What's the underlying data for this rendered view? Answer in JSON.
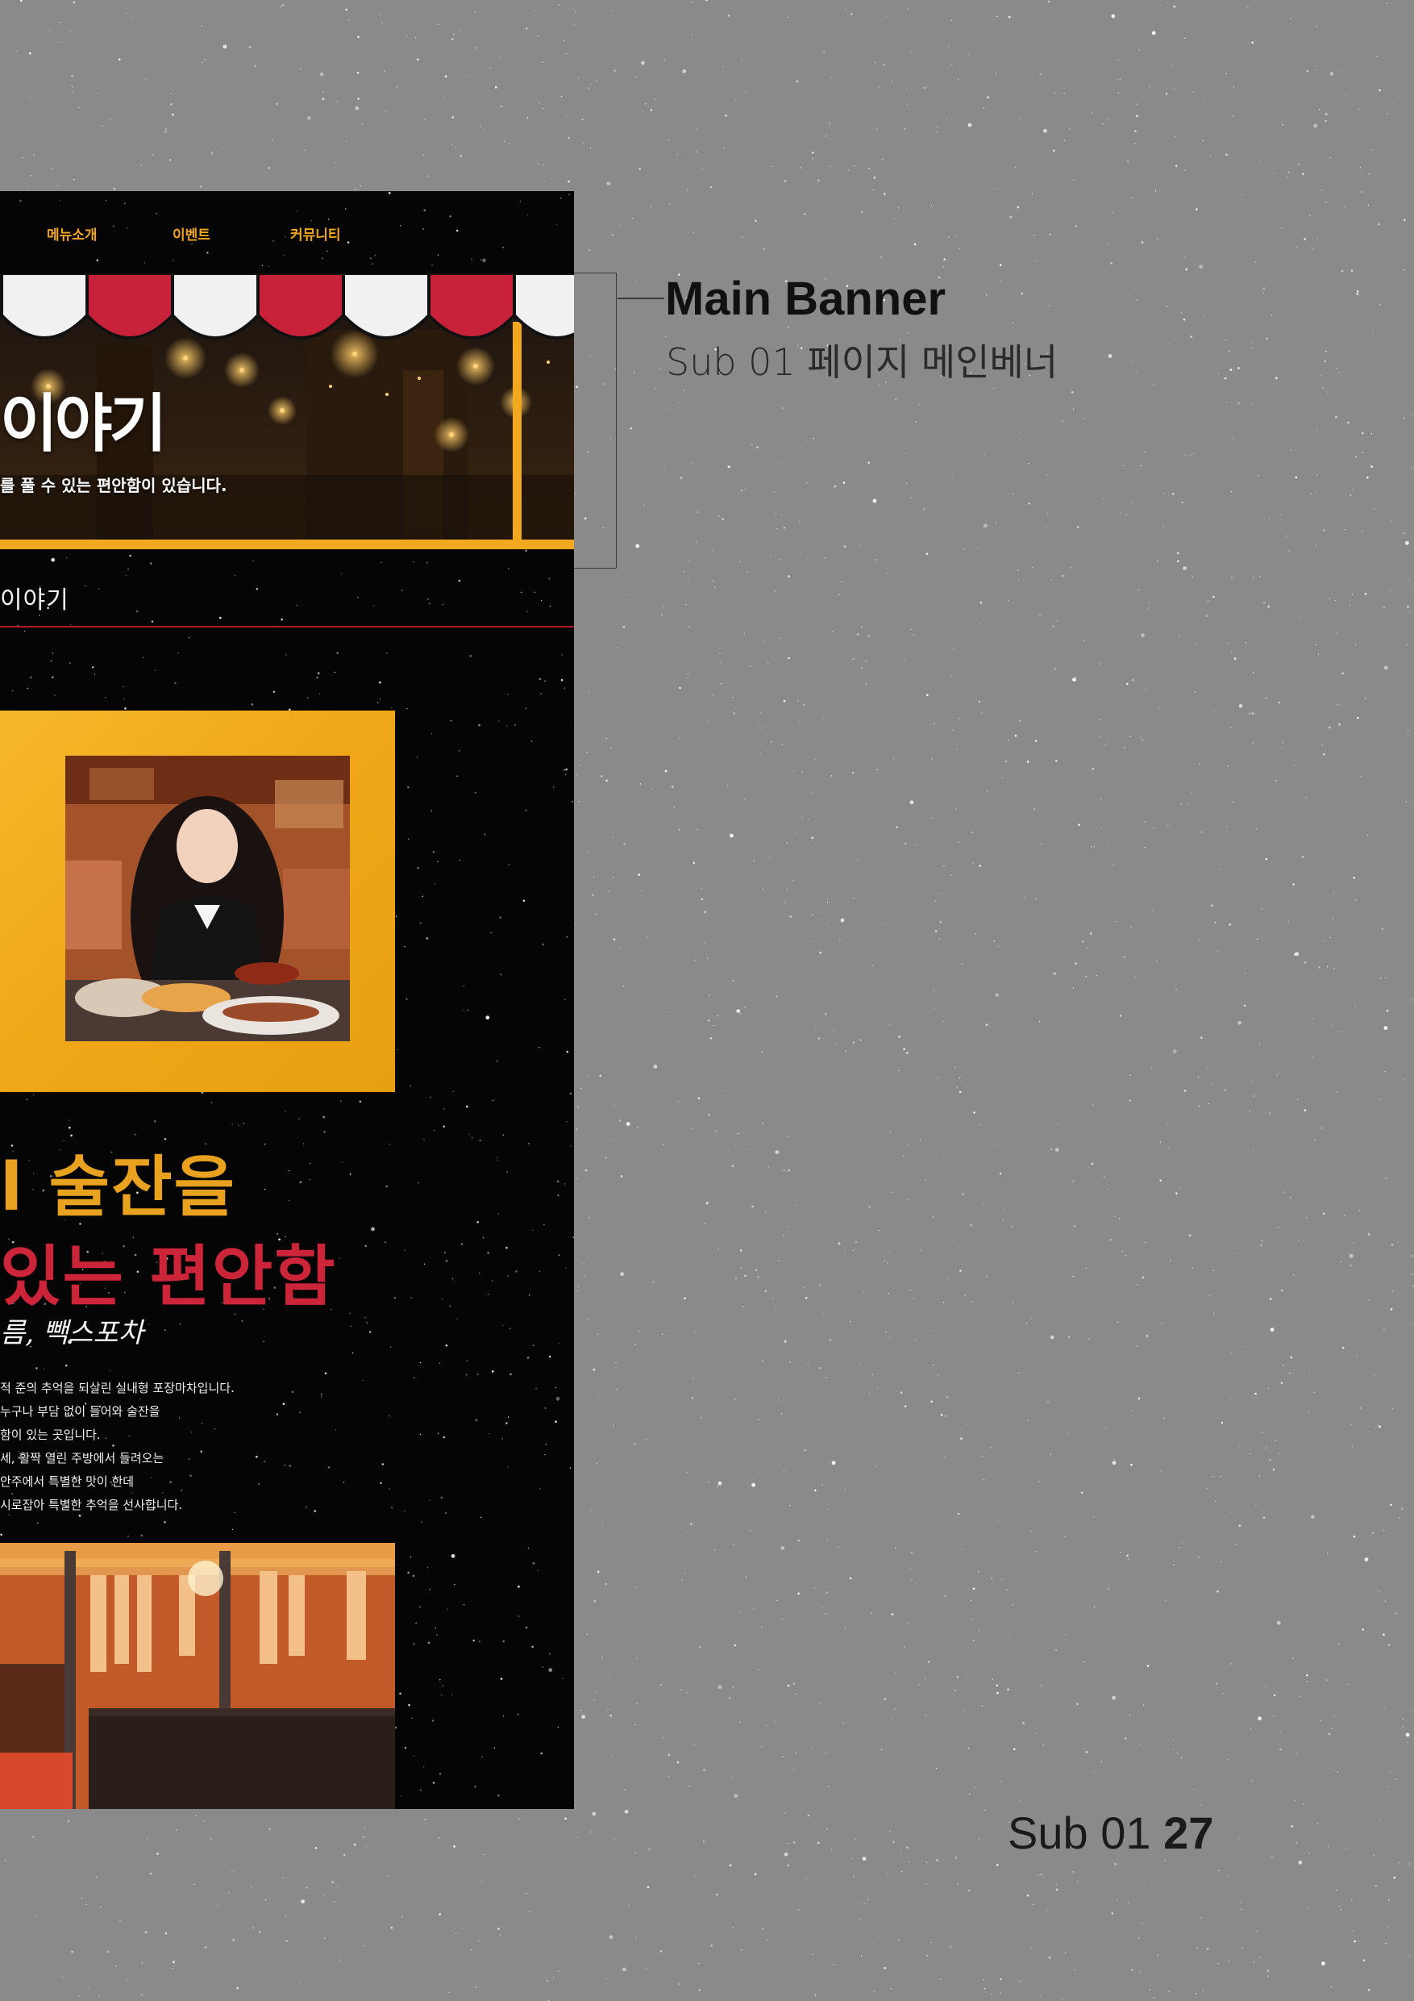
{
  "nav": {
    "items": [
      "메뉴소개",
      "이벤트",
      "커뮤니티"
    ]
  },
  "banner": {
    "title": "이야기",
    "subtitle": "를 풀 수 있는 편안함이 있습니다."
  },
  "section": {
    "title": "이야기"
  },
  "story": {
    "headline_1": "l 술잔을",
    "headline_2": "있는 편안함",
    "script_line": "름, 빽스포차",
    "description": [
      "적 준의 추억을 되살린 실내형 포장마차입니다.",
      "누구나 부담 없이 들어와 술잔을",
      "함이 있는 곳입니다.",
      "세, 활짝 열린 주방에서 들려오는",
      "안주에서 특별한 맛이 한데",
      "시로잡아 특별한 추억을 선사합니다."
    ]
  },
  "annotation": {
    "title": "Main Banner",
    "subtitle": "Sub 01 페이지 메인베너"
  },
  "footer": {
    "section_label": "Sub 01",
    "page_number": "27"
  },
  "colors": {
    "background": "#8a8a8a",
    "panel": "#050505",
    "accent_yellow": "#f2a71f",
    "accent_red": "#cc2438",
    "awning_white": "#f1f1f1",
    "awning_red": "#c8213a"
  }
}
